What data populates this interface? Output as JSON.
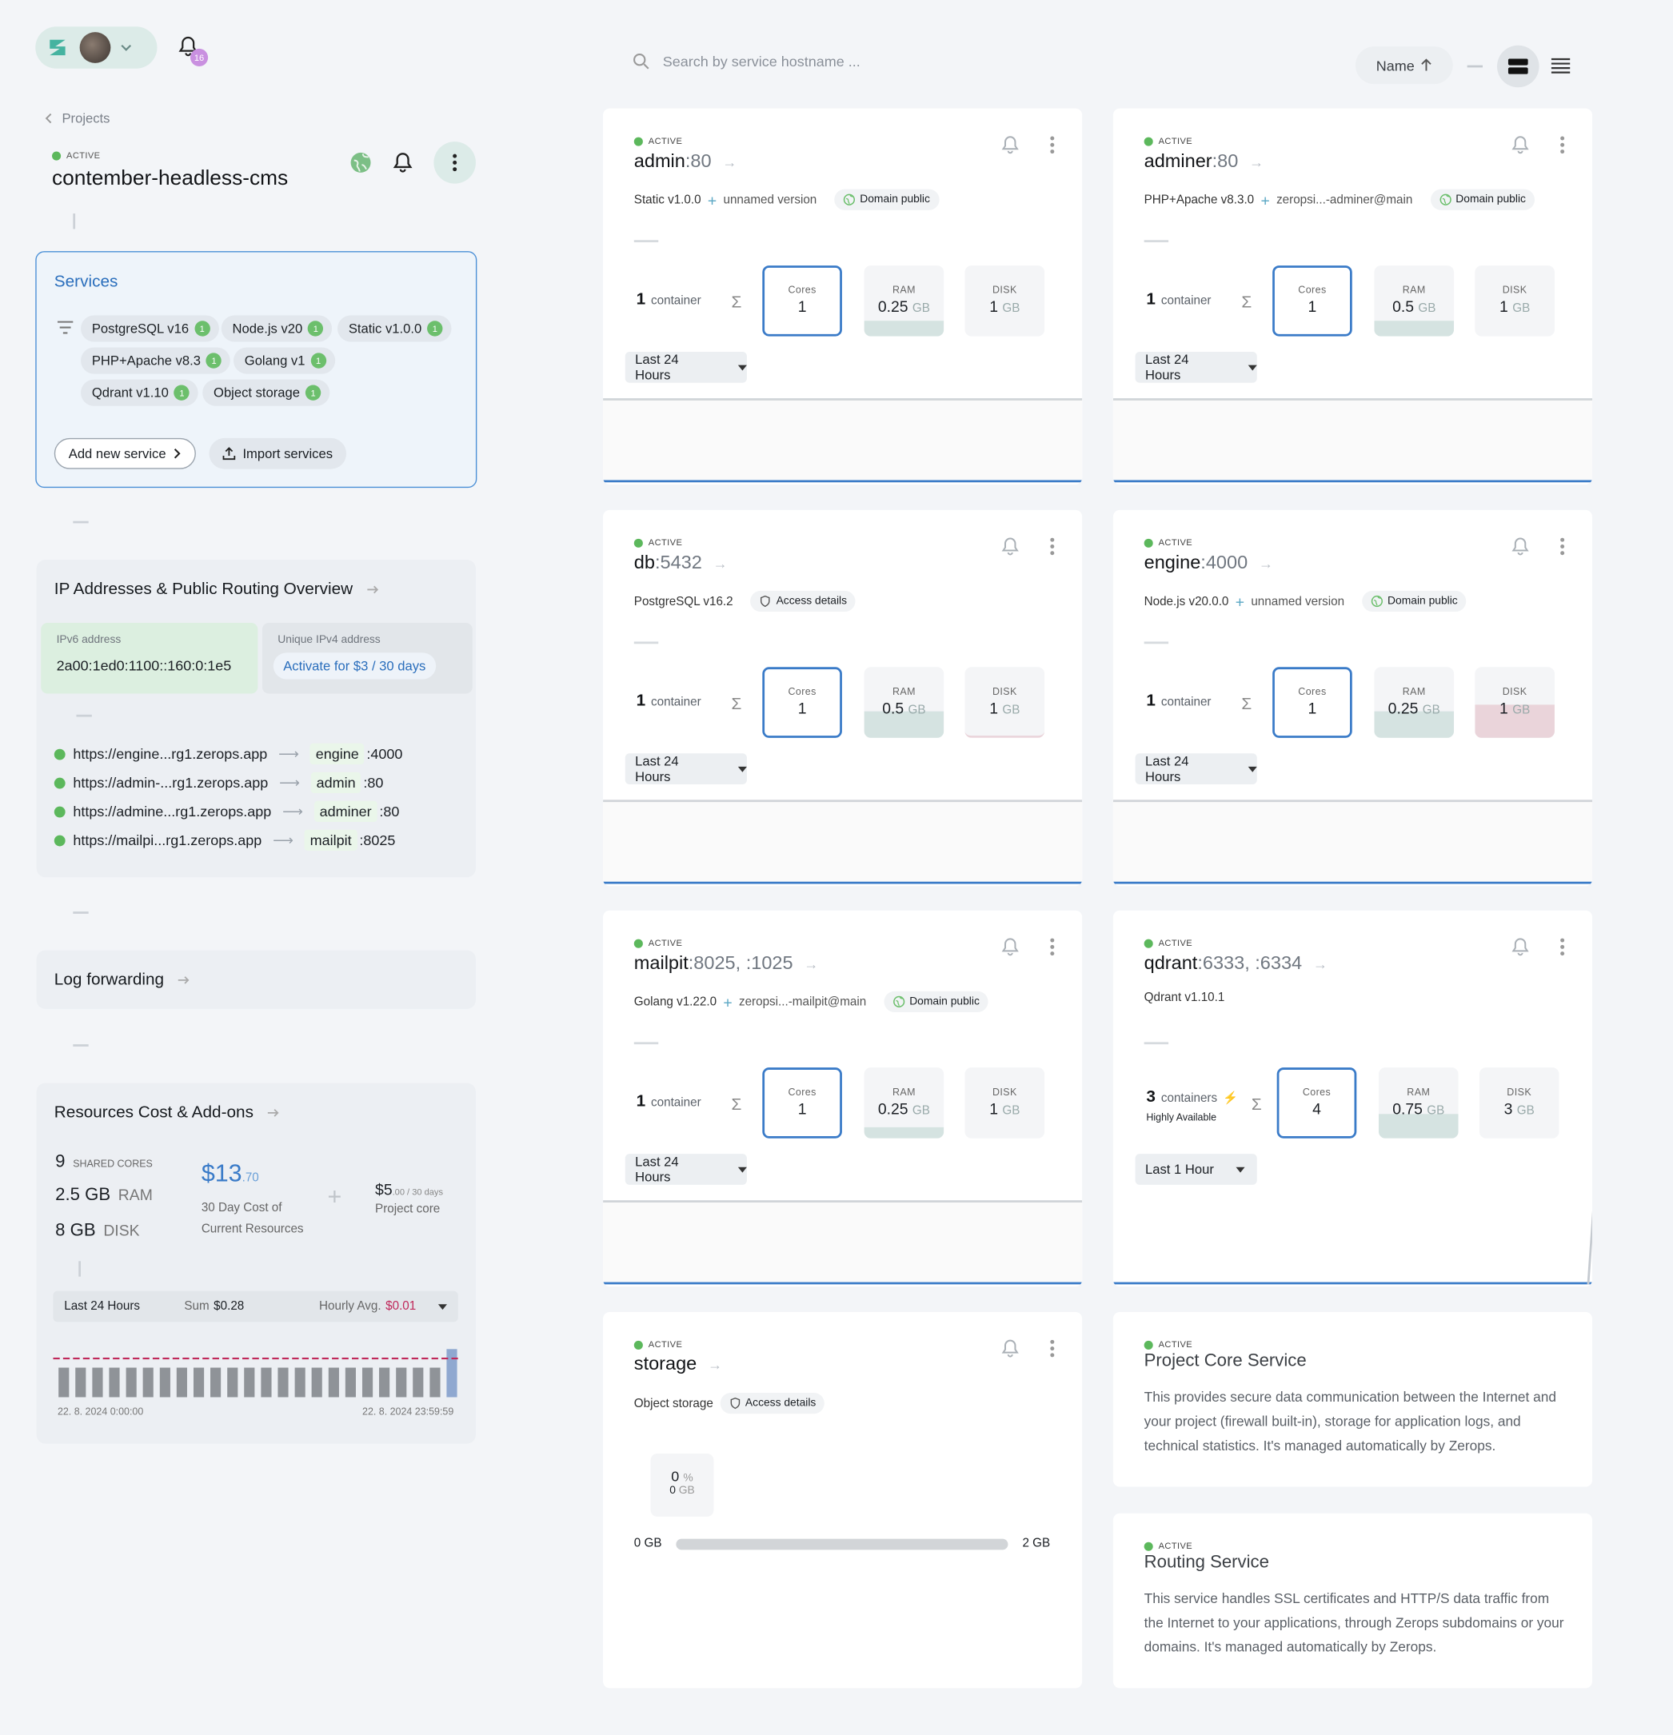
{
  "header": {
    "notifications_count": "16",
    "breadcrumb": "Projects"
  },
  "project": {
    "status": "ACTIVE",
    "name": "contember-headless-cms"
  },
  "services_box": {
    "title": "Services",
    "chips": [
      {
        "label": "PostgreSQL v16",
        "count": "1"
      },
      {
        "label": "Node.js v20",
        "count": "1"
      },
      {
        "label": "Static v1.0.0",
        "count": "1"
      },
      {
        "label": "PHP+Apache v8.3",
        "count": "1"
      },
      {
        "label": "Golang v1",
        "count": "1"
      },
      {
        "label": "Qdrant v1.10",
        "count": "1"
      },
      {
        "label": "Object storage",
        "count": "1"
      }
    ],
    "add_button": "Add new service",
    "import_button": "Import services"
  },
  "ip_panel": {
    "title": "IP Addresses & Public Routing Overview",
    "ipv6_label": "IPv6 address",
    "ipv6_value": "2a00:1ed0:1100::160:0:1e5",
    "ipv4_label": "Unique IPv4 address",
    "ipv4_action": "Activate for $3 / 30 days",
    "routes": [
      {
        "url": "https://engine...rg1.zerops.app",
        "host": "engine",
        "port": ":4000"
      },
      {
        "url": "https://admin-...rg1.zerops.app",
        "host": "admin",
        "port": ":80"
      },
      {
        "url": "https://admine...rg1.zerops.app",
        "host": "adminer",
        "port": ":80"
      },
      {
        "url": "https://mailpi...rg1.zerops.app",
        "host": "mailpit",
        "port": ":8025"
      }
    ]
  },
  "log_panel": {
    "title": "Log forwarding"
  },
  "cost_panel": {
    "title": "Resources Cost & Add-ons",
    "cores_value": "9",
    "cores_label": "SHARED CORES",
    "ram_value": "2.5 GB",
    "ram_label": "RAM",
    "disk_value": "8 GB",
    "disk_label": "DISK",
    "cost_main": "$13",
    "cost_cents": ".70",
    "cost_label_1": "30 Day Cost of",
    "cost_label_2": "Current Resources",
    "core_main": "$5",
    "core_cents": ".00 / 30 days",
    "core_label": "Project core",
    "range": "Last 24 Hours",
    "sum_label": "Sum",
    "sum_value": "$0.28",
    "avg_label": "Hourly Avg.",
    "avg_value": "$0.01",
    "start_time": "22. 8. 2024 0:00:00",
    "end_time": "22. 8. 2024 23:59:59",
    "bars": [
      0.38,
      0.38,
      0.38,
      0.38,
      0.38,
      0.38,
      0.38,
      0.38,
      0.38,
      0.38,
      0.38,
      0.38,
      0.38,
      0.38,
      0.38,
      0.38,
      0.38,
      0.38,
      0.38,
      0.38,
      0.38,
      0.38,
      0.38,
      0.62
    ]
  },
  "toolbar": {
    "search_placeholder": "Search by service hostname ...",
    "sort_label": "Name"
  },
  "cards": [
    {
      "status": "ACTIVE",
      "host": "admin",
      "port": ":80",
      "tech": "Static v1.0.0",
      "extra": "unnamed version",
      "badge": "Domain public",
      "badge_type": "globe",
      "containers": "1",
      "containers_label": "container",
      "cores": "1",
      "ram": "0.25",
      "ram_unit": "GB",
      "disk": "1",
      "disk_unit": "GB",
      "range": "Last 24 Hours"
    },
    {
      "status": "ACTIVE",
      "host": "adminer",
      "port": ":80",
      "tech": "PHP+Apache v8.3.0",
      "extra": "zeropsi...-adminer@main",
      "badge": "Domain public",
      "badge_type": "globe",
      "containers": "1",
      "containers_label": "container",
      "cores": "1",
      "ram": "0.5",
      "ram_unit": "GB",
      "disk": "1",
      "disk_unit": "GB",
      "range": "Last 24 Hours"
    },
    {
      "status": "ACTIVE",
      "host": "db",
      "port": ":5432",
      "tech": "PostgreSQL v16.2",
      "extra": "",
      "badge": "Access details",
      "badge_type": "shield",
      "containers": "1",
      "containers_label": "container",
      "cores": "1",
      "ram": "0.5",
      "ram_unit": "GB",
      "disk": "1",
      "disk_unit": "GB",
      "range": "Last 24 Hours"
    },
    {
      "status": "ACTIVE",
      "host": "engine",
      "port": ":4000",
      "tech": "Node.js v20.0.0",
      "extra": "unnamed version",
      "badge": "Domain public",
      "badge_type": "globe",
      "containers": "1",
      "containers_label": "container",
      "cores": "1",
      "ram": "0.25",
      "ram_unit": "GB",
      "disk": "1",
      "disk_unit": "GB",
      "range": "Last 24 Hours"
    },
    {
      "status": "ACTIVE",
      "host": "mailpit",
      "port": ":8025, :1025",
      "tech": "Golang v1.22.0",
      "extra": "zeropsi...-mailpit@main",
      "badge": "Domain public",
      "badge_type": "globe",
      "containers": "1",
      "containers_label": "container",
      "cores": "1",
      "ram": "0.25",
      "ram_unit": "GB",
      "disk": "1",
      "disk_unit": "GB",
      "range": "Last 24 Hours"
    },
    {
      "status": "ACTIVE",
      "host": "qdrant",
      "port": ":6333, :6334",
      "tech": "Qdrant v1.10.1",
      "extra": "",
      "badge": "",
      "badge_type": "",
      "containers": "3",
      "containers_label": "containers",
      "ha_label": "Highly Available",
      "cores": "4",
      "ram": "0.75",
      "ram_unit": "GB",
      "disk": "3",
      "disk_unit": "GB",
      "range": "Last 1 Hour"
    }
  ],
  "storage_card": {
    "status": "ACTIVE",
    "host": "storage",
    "tech": "Object storage",
    "badge": "Access details",
    "pct": "0",
    "pct_unit": "%",
    "used": "0",
    "used_unit": "GB",
    "min": "0 GB",
    "max": "2 GB"
  },
  "core_service": {
    "status": "ACTIVE",
    "title": "Project Core Service",
    "desc": "This provides secure data communication between the Internet and your project (firewall built-in), storage for application logs, and technical statistics. It's managed automatically by Zerops."
  },
  "routing_service": {
    "status": "ACTIVE",
    "title": "Routing Service",
    "desc": "This service handles SSL certificates and HTTP/S data traffic from the Internet to your applications, through Zerops subdomains or your domains. It's managed automatically by Zerops."
  },
  "colors": {
    "accent": "#3a7bc8",
    "active": "#5cb85c",
    "ram_fill": "#d5e3e1",
    "disk_warn": "#ead4da",
    "avg_dash": "#c0285a"
  }
}
